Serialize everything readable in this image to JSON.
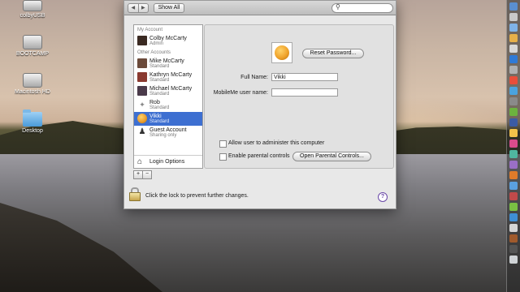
{
  "desktop": {
    "icons": [
      {
        "label": "colbyUSB",
        "kind": "drive"
      },
      {
        "label": "BOOTCAMP",
        "kind": "drive"
      },
      {
        "label": "Macintosh HD",
        "kind": "drive"
      },
      {
        "label": "Desktop",
        "kind": "folder"
      }
    ]
  },
  "toolbar": {
    "back_label": "◀",
    "forward_label": "▶",
    "show_all_label": "Show All",
    "search_icon": "magnifier-icon",
    "search_placeholder": ""
  },
  "sidebar": {
    "my_account_header": "My Account",
    "other_accounts_header": "Other Accounts",
    "my_account": {
      "name": "Colby McCarty",
      "type": "Admin"
    },
    "accounts": [
      {
        "name": "Mike McCarty",
        "type": "Standard",
        "color": "#6b4a3a"
      },
      {
        "name": "Kathryn McCarty",
        "type": "Standard",
        "color": "#8a3a30"
      },
      {
        "name": "Michael McCarty",
        "type": "Standard",
        "color": "#4a3a4a"
      },
      {
        "name": "Rob",
        "type": "Standard",
        "color": "#ffffff"
      },
      {
        "name": "Vikki",
        "type": "Standard",
        "color": "#e89a2a",
        "selected": true
      },
      {
        "name": "Guest Account",
        "type": "Sharing only",
        "color": "#333333"
      }
    ],
    "login_options_label": "Login Options",
    "add_label": "+",
    "remove_label": "−"
  },
  "main": {
    "reset_password_label": "Reset Password...",
    "full_name_label": "Full Name:",
    "full_name_value": "Vikki",
    "mobileme_label": "MobileMe user name:",
    "mobileme_value": "",
    "allow_admin_label": "Allow user to administer this computer",
    "allow_admin_checked": false,
    "parental_label": "Enable parental controls",
    "parental_checked": false,
    "open_parental_label": "Open Parental Controls..."
  },
  "footer": {
    "lock_text": "Click the lock to prevent further changes.",
    "help_label": "?"
  },
  "colors": {
    "selection": "#3d6fd1",
    "help": "#6a49a8"
  }
}
